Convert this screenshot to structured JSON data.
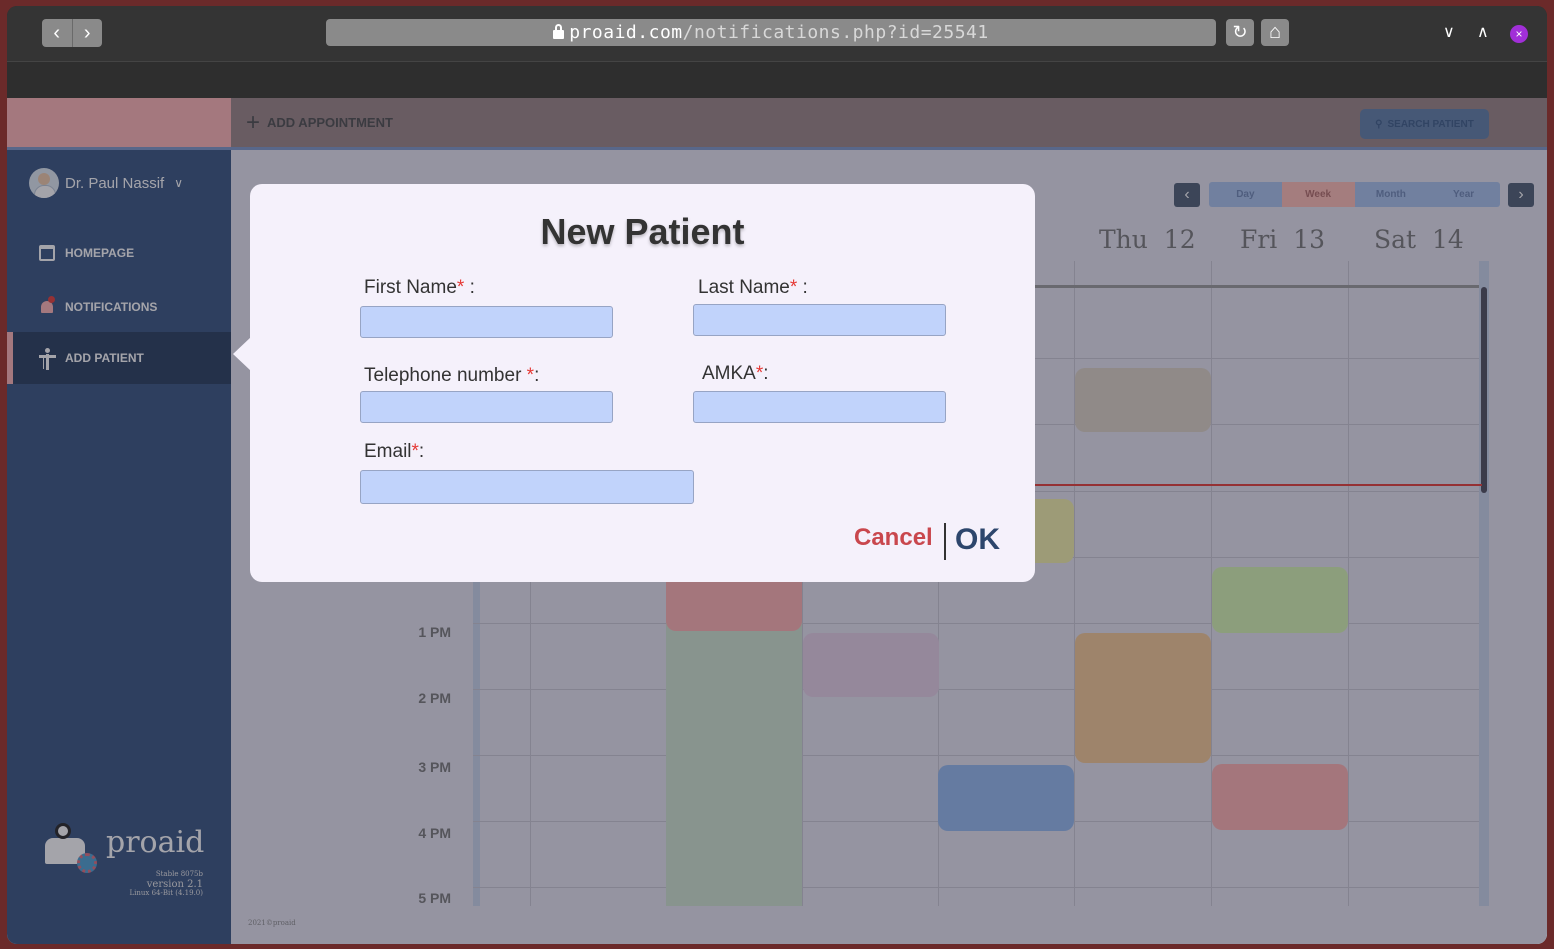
{
  "browser": {
    "back_label": "‹",
    "forward_label": "›",
    "url_host": "proaid.com",
    "url_path": "/notifications.php?id=25541",
    "reload_label": "↻",
    "home_label": "⌂",
    "minimize_label": "∨",
    "maximize_label": "∧",
    "close_label": "×",
    "close_color": "#a12fd8"
  },
  "topbar": {
    "add_appointment_label": "ADD APPOINTMENT",
    "search_placeholder": "SEARCH PATIENT"
  },
  "sidebar": {
    "user_name": "Dr. Paul Nassif",
    "items": [
      {
        "label": "HOMEPAGE",
        "icon": "calendar-icon"
      },
      {
        "label": "NOTIFICATIONS",
        "icon": "bell-icon"
      },
      {
        "label": "ADD PATIENT",
        "icon": "person-icon",
        "active": true
      }
    ],
    "brand": {
      "name": "proaid",
      "stable": "Stable 8075b",
      "version": "version 2.1",
      "platform": "Linux 64-Bit (4.19.0)"
    }
  },
  "calendar": {
    "views": [
      "Day",
      "Week",
      "Month",
      "Year"
    ],
    "active_view": "Week",
    "day_headers": [
      {
        "day": "Thu",
        "date": "12"
      },
      {
        "day": "Fri",
        "date": "13"
      },
      {
        "day": "Sat",
        "date": "14"
      }
    ],
    "hour_labels": [
      "1 PM",
      "2 PM",
      "3 PM",
      "4 PM",
      "5 PM"
    ],
    "footer": "2021©proaid",
    "colors": {
      "red": "#ffb0b0",
      "yellow": "#f3f0a8",
      "green": "#d6f5b0",
      "purple": "#e6cfe6",
      "orange": "#f4c993",
      "blue": "#93b9f0",
      "tan": "#ddd2c4"
    }
  },
  "modal": {
    "title": "New Patient",
    "fields": {
      "first_name": {
        "label": "First Name",
        "value": ""
      },
      "last_name": {
        "label": "Last Name",
        "value": ""
      },
      "telephone": {
        "label": "Telephone number",
        "value": ""
      },
      "amka": {
        "label": "AMKA",
        "value": ""
      },
      "email": {
        "label": "Email",
        "value": ""
      }
    },
    "required_marker": "*",
    "cancel_label": "Cancel",
    "ok_label": "OK"
  }
}
